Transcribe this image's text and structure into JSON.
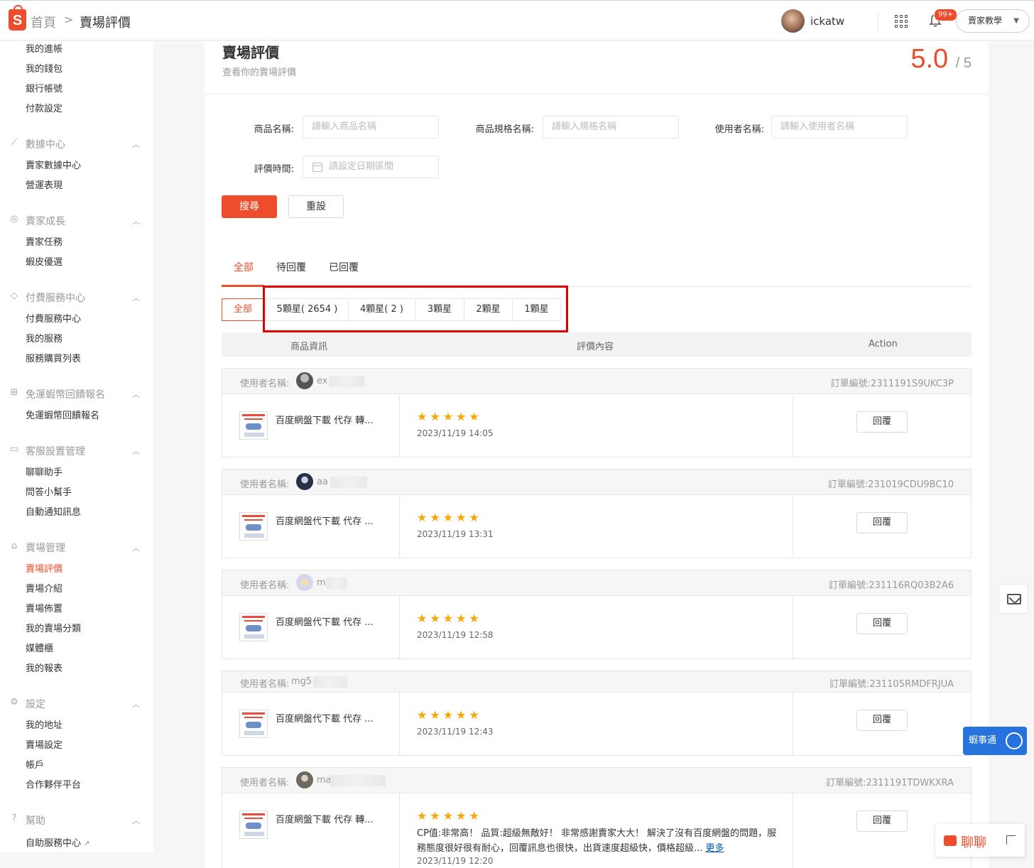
{
  "header": {
    "breadcrumb_home": "首頁",
    "breadcrumb_sep": ">",
    "breadcrumb_current": "賣場評價",
    "user_name": "ickatw",
    "notification_badge": "99+",
    "tutorial_label": "賣家教學"
  },
  "sidebar": {
    "items_top": [
      "我的進帳",
      "我的錢包",
      "銀行帳號",
      "付款設定"
    ],
    "groups": [
      {
        "title": "數據中心",
        "icon": "chart-icon",
        "items": [
          "賣家數據中心",
          "營運表現"
        ]
      },
      {
        "title": "賣家成長",
        "icon": "location-icon",
        "items": [
          "賣家任務",
          "蝦皮優選"
        ]
      },
      {
        "title": "付費服務中心",
        "icon": "diamond-icon",
        "items": [
          "付費服務中心",
          "我的服務",
          "服務購買列表"
        ]
      },
      {
        "title": "免運蝦幣回饋報名",
        "icon": "grid-icon",
        "items": [
          "免運蝦幣回饋報名"
        ]
      },
      {
        "title": "客服設置管理",
        "icon": "chat-icon",
        "items": [
          "聊聊助手",
          "問答小幫手",
          "自動通知訊息"
        ]
      },
      {
        "title": "賣場管理",
        "icon": "shop-icon",
        "items": [
          "賣場評價",
          "賣場介紹",
          "賣場佈置",
          "我的賣場分類",
          "媒體櫃",
          "我的報表"
        ]
      },
      {
        "title": "設定",
        "icon": "gear-icon",
        "items": [
          "我的地址",
          "賣場設定",
          "帳戶",
          "合作夥伴平台"
        ]
      },
      {
        "title": "幫助",
        "icon": "help-icon",
        "items": [
          "自助服務中心"
        ]
      }
    ],
    "active_item": "賣場評價"
  },
  "page": {
    "title": "賣場評價",
    "subtitle": "查看你的賣場評價",
    "score": "5.0",
    "score_of": "/ 5"
  },
  "filters": {
    "product_label": "商品名稱:",
    "product_placeholder": "請輸入商品名稱",
    "spec_label": "商品規格名稱:",
    "spec_placeholder": "請輸入規格名稱",
    "user_label": "使用者名稱:",
    "user_placeholder": "請輸入使用者名稱",
    "time_label": "評價時間:",
    "time_placeholder": "請設定日期區間",
    "search_label": "搜尋",
    "reset_label": "重設"
  },
  "tabs": [
    "全部",
    "待回覆",
    "已回覆"
  ],
  "star_filters": [
    "全部",
    "5顆星( 2654 )",
    "4顆星( 2 )",
    "3顆星",
    "2顆星",
    "1顆星"
  ],
  "table_headers": [
    "商品資訊",
    "評價內容",
    "Action"
  ],
  "review_user_label": "使用者名稱:",
  "reply_label": "回覆",
  "reviews": [
    {
      "user": "ex",
      "order": "訂單編號:2311191S9UKC3P",
      "product": "百度網盤下載 代存 轉...",
      "stars": "★★★★★",
      "time": "2023/11/19 14:05",
      "comment": ""
    },
    {
      "user": "aa",
      "order": "訂單編號:231019CDU9BC10",
      "product": "百度網盤代下載 代存 ...",
      "stars": "★★★★★",
      "time": "2023/11/19 13:31",
      "comment": ""
    },
    {
      "user": "m",
      "order": "訂單編號:231116RQ03B2A6",
      "product": "百度網盤代下載 代存 ...",
      "stars": "★★★★★",
      "time": "2023/11/19 12:58",
      "comment": ""
    },
    {
      "user": "mg5",
      "order": "訂單編號:231105RMDFRJUA",
      "product": "百度網盤代下載 代存 ...",
      "stars": "★★★★★",
      "time": "2023/11/19 12:43",
      "comment": ""
    },
    {
      "user": "ma",
      "order": "訂單編號:2311191TDWKXRA",
      "product": "百度網盤下載 代存 轉...",
      "stars": "★★★★★",
      "time": "2023/11/19 12:20",
      "comment": "CP值:非常高！ 品質:超級無敵好！ 非常感謝賣家大大！ 解決了沒有百度網盤的問題，服務態度很好很有耐心，回覆訊息也很快，出貨速度超級快，價格超級...",
      "more": "更多"
    }
  ],
  "floating": {
    "assistant_label": "蝦事通",
    "chat_label": "聊聊"
  }
}
